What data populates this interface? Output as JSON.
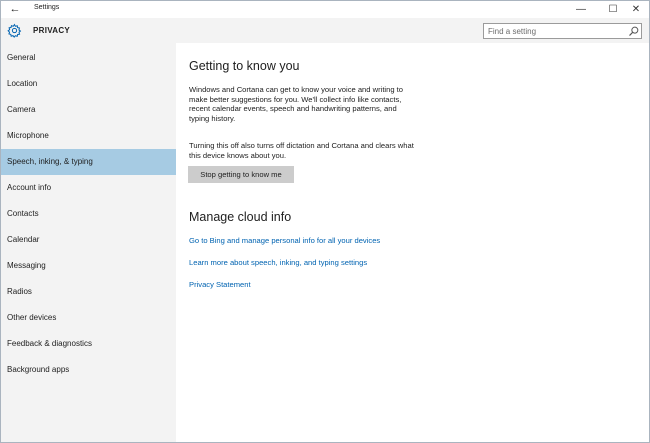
{
  "window": {
    "title": "Settings",
    "back_glyph": "←",
    "min_glyph": "—",
    "max_glyph": "☐",
    "close_glyph": "✕"
  },
  "header": {
    "icon": "gear-icon",
    "title": "PRIVACY"
  },
  "search": {
    "placeholder": "Find a setting",
    "value": "",
    "icon": "search-icon"
  },
  "sidebar": {
    "selected_index": 4,
    "items": [
      {
        "label": "General"
      },
      {
        "label": "Location"
      },
      {
        "label": "Camera"
      },
      {
        "label": "Microphone"
      },
      {
        "label": "Speech, inking, & typing"
      },
      {
        "label": "Account info"
      },
      {
        "label": "Contacts"
      },
      {
        "label": "Calendar"
      },
      {
        "label": "Messaging"
      },
      {
        "label": "Radios"
      },
      {
        "label": "Other devices"
      },
      {
        "label": "Feedback & diagnostics"
      },
      {
        "label": "Background apps"
      }
    ]
  },
  "main": {
    "getting_to_know": {
      "heading": "Getting to know you",
      "paragraph1": {
        "line1": "Windows and Cortana can get to know your voice and writing to",
        "line2": "make better suggestions for you. We'll collect info like contacts,",
        "line3": "recent calendar events, speech and handwriting patterns, and",
        "line4": "typing history."
      },
      "paragraph2": {
        "line1": "Turning this off also turns off dictation and Cortana and clears what",
        "line2": "this device knows about you."
      },
      "button_label": "Stop getting to know me"
    },
    "cloud_info": {
      "heading": "Manage cloud info",
      "links": [
        {
          "label": "Go to Bing and manage personal info for all your devices"
        },
        {
          "label": "Learn more about speech, inking, and typing settings"
        },
        {
          "label": "Privacy Statement"
        }
      ]
    }
  },
  "colors": {
    "accent": "#0063b1",
    "selected_nav": "#a6cbe3",
    "sidebar_bg": "#f3f3f3",
    "button_bg": "#cccccc"
  }
}
